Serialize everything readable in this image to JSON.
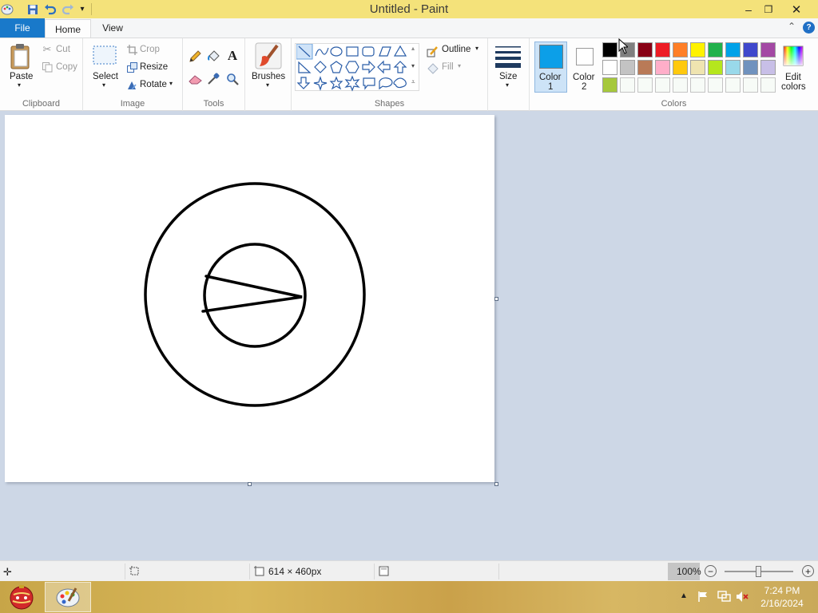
{
  "window": {
    "title": "Untitled - Paint"
  },
  "tabs": {
    "file": "File",
    "home": "Home",
    "view": "View"
  },
  "clipboard": {
    "paste": "Paste",
    "cut": "Cut",
    "copy": "Copy",
    "label": "Clipboard"
  },
  "image": {
    "select": "Select",
    "crop": "Crop",
    "resize": "Resize",
    "rotate": "Rotate",
    "label": "Image"
  },
  "tools": {
    "label": "Tools"
  },
  "brushes": {
    "label": "Brushes"
  },
  "shapes": {
    "outline": "Outline",
    "fill": "Fill",
    "label": "Shapes"
  },
  "size": {
    "label": "Size"
  },
  "colors": {
    "color1_a": "Color",
    "color1_b": "1",
    "color2_a": "Color",
    "color2_b": "2",
    "edit_a": "Edit",
    "edit_b": "colors",
    "label": "Colors",
    "color1_value": "#0c9fe8",
    "color2_value": "#ffffff",
    "row1": [
      "#000000",
      "#7f7f7f",
      "#880015",
      "#ed1c24",
      "#ff7f27",
      "#fff200",
      "#22b14c",
      "#00a2e8",
      "#3f48cc",
      "#a349a4"
    ],
    "row2": [
      "#ffffff",
      "#c3c3c3",
      "#b97a57",
      "#ffaec9",
      "#ffc90e",
      "#efe4b0",
      "#b5e61d",
      "#99d9ea",
      "#7092be",
      "#c8bfe7"
    ],
    "row3_first": "#a6c83c"
  },
  "statusbar": {
    "dimensions": "614 × 460px",
    "zoom": "100%"
  },
  "taskbar": {
    "time": "7:24 PM",
    "date": "2/16/2024"
  }
}
